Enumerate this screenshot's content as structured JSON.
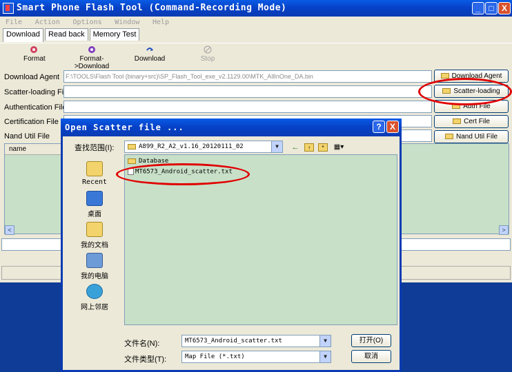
{
  "window": {
    "title": "Smart Phone Flash Tool (Command-Recording Mode)",
    "minimize": "_",
    "maximize": "□",
    "close": "X"
  },
  "menu": [
    "File",
    "Action",
    "Options",
    "Window",
    "Help"
  ],
  "tabs": [
    "Download",
    "Read back",
    "Memory Test"
  ],
  "toolbar": {
    "format": "Format",
    "format_download": "Format->Download",
    "download": "Download",
    "stop": "Stop"
  },
  "rows": {
    "download_agent": {
      "label": "Download Agent",
      "value": "F:\\TOOLS\\Flash Tool (binary+src)\\SP_Flash_Tool_exe_v2.1129.00\\MTK_AllInOne_DA.bin",
      "button": "Download Agent"
    },
    "scatter": {
      "label": "Scatter-loading File",
      "value": "",
      "button": "Scatter-loading"
    },
    "auth": {
      "label": "Authentication File",
      "value": "",
      "button": "Auth File"
    },
    "cert": {
      "label": "Certification File",
      "value": "",
      "button": "Cert File"
    },
    "nand": {
      "label": "Nand Util File",
      "value": "",
      "button": "Nand Util File"
    }
  },
  "list": {
    "column": "name"
  },
  "dialog": {
    "title": "Open Scatter file ...",
    "help": "?",
    "close": "X",
    "look_in_label": "查找范围(I):",
    "look_in_value": "A899_R2_A2_v1.16_20120111_02",
    "places": [
      "Recent",
      "桌面",
      "我的文档",
      "我的电脑",
      "网上邻居"
    ],
    "files": [
      "Database",
      "MT6573_Android_scatter.txt"
    ],
    "filename_label": "文件名(N):",
    "filename_value": "MT6573_Android_scatter.txt",
    "filetype_label": "文件类型(T):",
    "filetype_value": "Map File (*.txt)",
    "open_button": "打开(O)",
    "cancel_button": "取消"
  },
  "colors": {
    "titlebar": "#0a46d0",
    "pane": "#c8e0c8",
    "highlight": "#e00000"
  }
}
